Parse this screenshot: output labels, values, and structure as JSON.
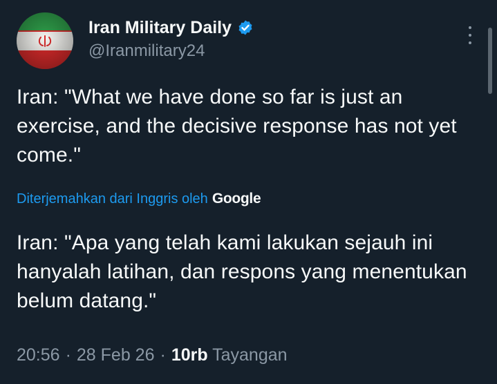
{
  "author": {
    "display_name": "Iran Military Daily",
    "handle": "@Iranmilitary24",
    "verified": true,
    "avatar_icon": "iran-flag-icon",
    "verified_color": "#1d9bf0"
  },
  "tweet": {
    "original_text": "Iran: \"What we have done so far is just an exercise, and the decisive response has not yet come.\"",
    "translation_note": "Diterjemahkan dari Inggris oleh",
    "translation_provider": "Google",
    "translated_text": "Iran: \"Apa yang telah kami lakukan sejauh ini hanyalah latihan, dan respons yang menentukan belum datang.\""
  },
  "meta": {
    "time": "20:56",
    "separator1": "·",
    "date": "28 Feb 26",
    "separator2": "·",
    "views_count": "10rb",
    "views_label": "Tayangan"
  },
  "colors": {
    "background": "#15202b",
    "accent": "#1d9bf0",
    "text_primary": "#f7f9f9",
    "text_secondary": "#8b98a5"
  }
}
